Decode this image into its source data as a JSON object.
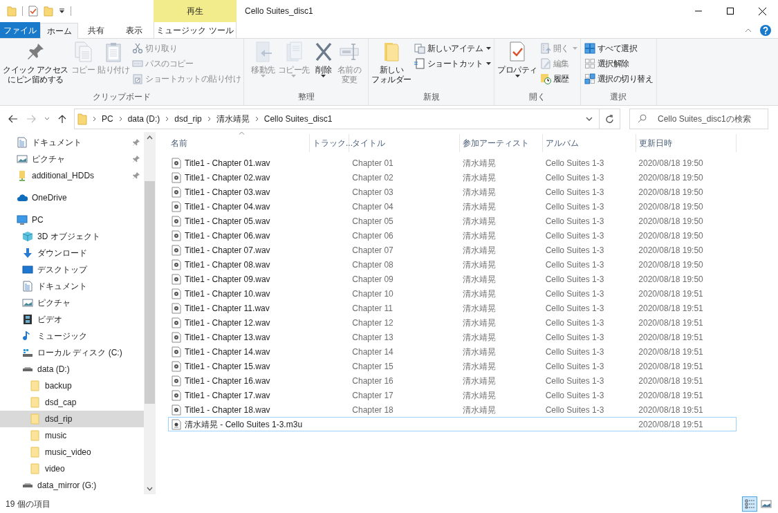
{
  "window": {
    "title": "Cello Suites_disc1",
    "contextual_tab_group": "再生"
  },
  "tabs": [
    {
      "label": "ファイル",
      "kind": "file",
      "selected": false
    },
    {
      "label": "ホーム",
      "kind": "normal",
      "selected": true
    },
    {
      "label": "共有",
      "kind": "normal",
      "selected": false
    },
    {
      "label": "表示",
      "kind": "normal",
      "selected": false
    },
    {
      "label": "ミュージック ツール",
      "kind": "contextual",
      "selected": false
    }
  ],
  "ribbon": {
    "groups": [
      {
        "label": "クリップボード",
        "items": [
          {
            "label": "クイック アクセスにピン留めする",
            "kind": "large",
            "disabled": false,
            "dropdown": false
          },
          {
            "label": "コピー",
            "kind": "large",
            "disabled": true,
            "dropdown": false
          },
          {
            "label": "貼り付け",
            "kind": "large",
            "disabled": true,
            "dropdown": false
          },
          {
            "label": "切り取り",
            "kind": "small",
            "disabled": true,
            "dropdown": false
          },
          {
            "label": "パスのコピー",
            "kind": "small",
            "disabled": true,
            "dropdown": false
          },
          {
            "label": "ショートカットの貼り付け",
            "kind": "small",
            "disabled": true,
            "dropdown": false
          }
        ]
      },
      {
        "label": "整理",
        "items": [
          {
            "label": "移動先",
            "kind": "large",
            "disabled": true,
            "dropdown": true
          },
          {
            "label": "コピー先",
            "kind": "large",
            "disabled": true,
            "dropdown": true
          },
          {
            "label": "削除",
            "kind": "large",
            "disabled": false,
            "dropdown": true
          },
          {
            "label": "名前の変更",
            "kind": "large",
            "disabled": true,
            "dropdown": false
          }
        ]
      },
      {
        "label": "新規",
        "items": [
          {
            "label": "新しいフォルダー",
            "kind": "large",
            "disabled": false,
            "dropdown": false
          },
          {
            "label": "新しいアイテム",
            "kind": "small",
            "disabled": false,
            "dropdown": true
          },
          {
            "label": "ショートカット",
            "kind": "small",
            "disabled": false,
            "dropdown": true
          }
        ]
      },
      {
        "label": "開く",
        "items": [
          {
            "label": "プロパティ",
            "kind": "large",
            "disabled": false,
            "dropdown": true
          },
          {
            "label": "開く",
            "kind": "small",
            "disabled": true,
            "dropdown": true
          },
          {
            "label": "編集",
            "kind": "small",
            "disabled": true,
            "dropdown": false
          },
          {
            "label": "履歴",
            "kind": "small",
            "disabled": false,
            "dropdown": false
          }
        ]
      },
      {
        "label": "選択",
        "items": [
          {
            "label": "すべて選択",
            "kind": "small",
            "disabled": false,
            "dropdown": false
          },
          {
            "label": "選択解除",
            "kind": "small",
            "disabled": false,
            "dropdown": false
          },
          {
            "label": "選択の切り替え",
            "kind": "small",
            "disabled": false,
            "dropdown": false
          }
        ]
      }
    ]
  },
  "address_bar": {
    "path": [
      "PC",
      "data (D:)",
      "dsd_rip",
      "清水靖晃",
      "Cello Suites_disc1"
    ]
  },
  "search": {
    "placeholder": "Cello Suites_disc1の検索"
  },
  "nav": [
    {
      "label": "ドキュメント",
      "kind": "document",
      "pinned": true,
      "selected": false
    },
    {
      "label": "ピクチャ",
      "kind": "picture",
      "pinned": true,
      "selected": false
    },
    {
      "label": "additional_HDDs",
      "kind": "network-folder",
      "pinned": true,
      "selected": false
    },
    {
      "label": "OneDrive",
      "kind": "cloud",
      "pinned": false,
      "selected": false
    },
    {
      "label": "PC",
      "kind": "pc",
      "pinned": false,
      "selected": false,
      "children": [
        {
          "label": "3D オブジェクト",
          "kind": "cube",
          "pinned": false,
          "selected": false
        },
        {
          "label": "ダウンロード",
          "kind": "download",
          "pinned": false,
          "selected": false
        },
        {
          "label": "デスクトップ",
          "kind": "desktop",
          "pinned": false,
          "selected": false
        },
        {
          "label": "ドキュメント",
          "kind": "document",
          "pinned": false,
          "selected": false
        },
        {
          "label": "ピクチャ",
          "kind": "picture",
          "pinned": false,
          "selected": false
        },
        {
          "label": "ビデオ",
          "kind": "video",
          "pinned": false,
          "selected": false
        },
        {
          "label": "ミュージック",
          "kind": "music",
          "pinned": false,
          "selected": false
        },
        {
          "label": "ローカル ディスク (C:)",
          "kind": "system-drive",
          "pinned": false,
          "selected": false
        },
        {
          "label": "data (D:)",
          "kind": "drive",
          "pinned": false,
          "selected": false,
          "children": [
            {
              "label": "backup",
              "kind": "folder",
              "pinned": false,
              "selected": false
            },
            {
              "label": "dsd_cap",
              "kind": "folder",
              "pinned": false,
              "selected": false
            },
            {
              "label": "dsd_rip",
              "kind": "folder",
              "pinned": false,
              "selected": true
            },
            {
              "label": "music",
              "kind": "folder",
              "pinned": false,
              "selected": false
            },
            {
              "label": "music_video",
              "kind": "folder",
              "pinned": false,
              "selected": false
            },
            {
              "label": "video",
              "kind": "folder",
              "pinned": false,
              "selected": false
            }
          ]
        },
        {
          "label": "data_mirror (G:)",
          "kind": "drive",
          "pinned": false,
          "selected": false
        }
      ]
    }
  ],
  "file_list": {
    "columns": [
      {
        "label": "名前",
        "sorted": true
      },
      {
        "label": "トラック...",
        "sorted": false
      },
      {
        "label": "タイトル",
        "sorted": false
      },
      {
        "label": "参加アーティスト",
        "sorted": false
      },
      {
        "label": "アルバム",
        "sorted": false
      },
      {
        "label": "更新日時",
        "sorted": false
      }
    ],
    "rows": [
      {
        "name": "Title1 - Chapter 01.wav",
        "kind": "audio",
        "title": "Chapter 01",
        "artist": "清水靖晃",
        "album": "Cello Suites 1-3",
        "modified": "2020/08/18 19:50",
        "focused": false
      },
      {
        "name": "Title1 - Chapter 02.wav",
        "kind": "audio",
        "title": "Chapter 02",
        "artist": "清水靖晃",
        "album": "Cello Suites 1-3",
        "modified": "2020/08/18 19:50",
        "focused": false
      },
      {
        "name": "Title1 - Chapter 03.wav",
        "kind": "audio",
        "title": "Chapter 03",
        "artist": "清水靖晃",
        "album": "Cello Suites 1-3",
        "modified": "2020/08/18 19:50",
        "focused": false
      },
      {
        "name": "Title1 - Chapter 04.wav",
        "kind": "audio",
        "title": "Chapter 04",
        "artist": "清水靖晃",
        "album": "Cello Suites 1-3",
        "modified": "2020/08/18 19:50",
        "focused": false
      },
      {
        "name": "Title1 - Chapter 05.wav",
        "kind": "audio",
        "title": "Chapter 05",
        "artist": "清水靖晃",
        "album": "Cello Suites 1-3",
        "modified": "2020/08/18 19:50",
        "focused": false
      },
      {
        "name": "Title1 - Chapter 06.wav",
        "kind": "audio",
        "title": "Chapter 06",
        "artist": "清水靖晃",
        "album": "Cello Suites 1-3",
        "modified": "2020/08/18 19:50",
        "focused": false
      },
      {
        "name": "Title1 - Chapter 07.wav",
        "kind": "audio",
        "title": "Chapter 07",
        "artist": "清水靖晃",
        "album": "Cello Suites 1-3",
        "modified": "2020/08/18 19:50",
        "focused": false
      },
      {
        "name": "Title1 - Chapter 08.wav",
        "kind": "audio",
        "title": "Chapter 08",
        "artist": "清水靖晃",
        "album": "Cello Suites 1-3",
        "modified": "2020/08/18 19:50",
        "focused": false
      },
      {
        "name": "Title1 - Chapter 09.wav",
        "kind": "audio",
        "title": "Chapter 09",
        "artist": "清水靖晃",
        "album": "Cello Suites 1-3",
        "modified": "2020/08/18 19:50",
        "focused": false
      },
      {
        "name": "Title1 - Chapter 10.wav",
        "kind": "audio",
        "title": "Chapter 10",
        "artist": "清水靖晃",
        "album": "Cello Suites 1-3",
        "modified": "2020/08/18 19:51",
        "focused": false
      },
      {
        "name": "Title1 - Chapter 11.wav",
        "kind": "audio",
        "title": "Chapter 11",
        "artist": "清水靖晃",
        "album": "Cello Suites 1-3",
        "modified": "2020/08/18 19:51",
        "focused": false
      },
      {
        "name": "Title1 - Chapter 12.wav",
        "kind": "audio",
        "title": "Chapter 12",
        "artist": "清水靖晃",
        "album": "Cello Suites 1-3",
        "modified": "2020/08/18 19:51",
        "focused": false
      },
      {
        "name": "Title1 - Chapter 13.wav",
        "kind": "audio",
        "title": "Chapter 13",
        "artist": "清水靖晃",
        "album": "Cello Suites 1-3",
        "modified": "2020/08/18 19:51",
        "focused": false
      },
      {
        "name": "Title1 - Chapter 14.wav",
        "kind": "audio",
        "title": "Chapter 14",
        "artist": "清水靖晃",
        "album": "Cello Suites 1-3",
        "modified": "2020/08/18 19:51",
        "focused": false
      },
      {
        "name": "Title1 - Chapter 15.wav",
        "kind": "audio",
        "title": "Chapter 15",
        "artist": "清水靖晃",
        "album": "Cello Suites 1-3",
        "modified": "2020/08/18 19:51",
        "focused": false
      },
      {
        "name": "Title1 - Chapter 16.wav",
        "kind": "audio",
        "title": "Chapter 16",
        "artist": "清水靖晃",
        "album": "Cello Suites 1-3",
        "modified": "2020/08/18 19:51",
        "focused": false
      },
      {
        "name": "Title1 - Chapter 17.wav",
        "kind": "audio",
        "title": "Chapter 17",
        "artist": "清水靖晃",
        "album": "Cello Suites 1-3",
        "modified": "2020/08/18 19:51",
        "focused": false
      },
      {
        "name": "Title1 - Chapter 18.wav",
        "kind": "audio",
        "title": "Chapter 18",
        "artist": "清水靖晃",
        "album": "Cello Suites 1-3",
        "modified": "2020/08/18 19:51",
        "focused": false
      },
      {
        "name": "清水靖晃 - Cello Suites 1-3.m3u",
        "kind": "playlist",
        "modified": "2020/08/18 19:51",
        "focused": true
      }
    ]
  },
  "status_bar": {
    "item_count": "19 個の項目",
    "views": [
      {
        "selected": true
      },
      {
        "selected": false
      }
    ]
  }
}
